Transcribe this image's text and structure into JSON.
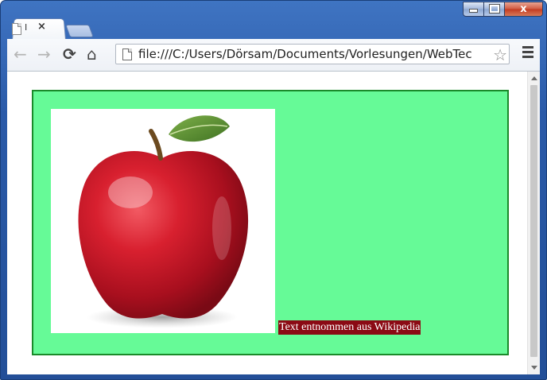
{
  "browser": {
    "tab": {
      "title": "I",
      "close_label": "×"
    },
    "window_buttons": {
      "close_label": "x"
    },
    "url": "file:///C:/Users/Dörsam/Documents/Vorlesungen/WebTec",
    "nav": {
      "back": "←",
      "forward": "→",
      "reload": "⟳",
      "home": "⌂",
      "star": "☆"
    }
  },
  "page": {
    "box_color": "#66fa97",
    "image": {
      "icon": "apple-image"
    },
    "caption": "Text entnommen aus Wikipedia",
    "caption_bg": "#8b0a14"
  }
}
